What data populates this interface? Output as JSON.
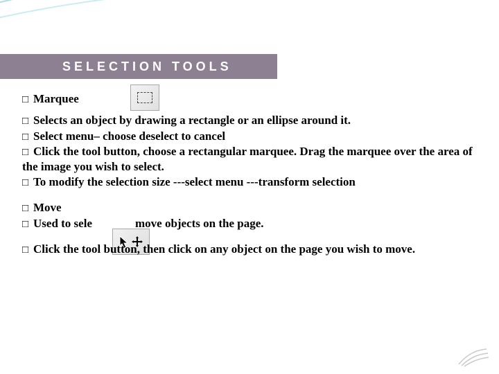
{
  "title": "SELECTION TOOLS",
  "bullets": [
    "Marquee",
    "Selects an object by drawing a rectangle or an ellipse around it.",
    "Select menu– choose deselect to cancel",
    "Click the tool button, choose a rectangular  marquee. Drag the marquee over the area of the image you wish to select.",
    "To modify the selection size ---select menu ---transform selection"
  ],
  "bullets2_a": "Move",
  "bullets2_b_pre": "Used to sele",
  "bullets2_b_post": "move objects on the page.",
  "bullets3": "Click the tool button, then click on any object on the page you wish to move.",
  "marker": "□",
  "icons": {
    "marquee": "marquee-tool-icon",
    "move": "move-tool-icon"
  }
}
